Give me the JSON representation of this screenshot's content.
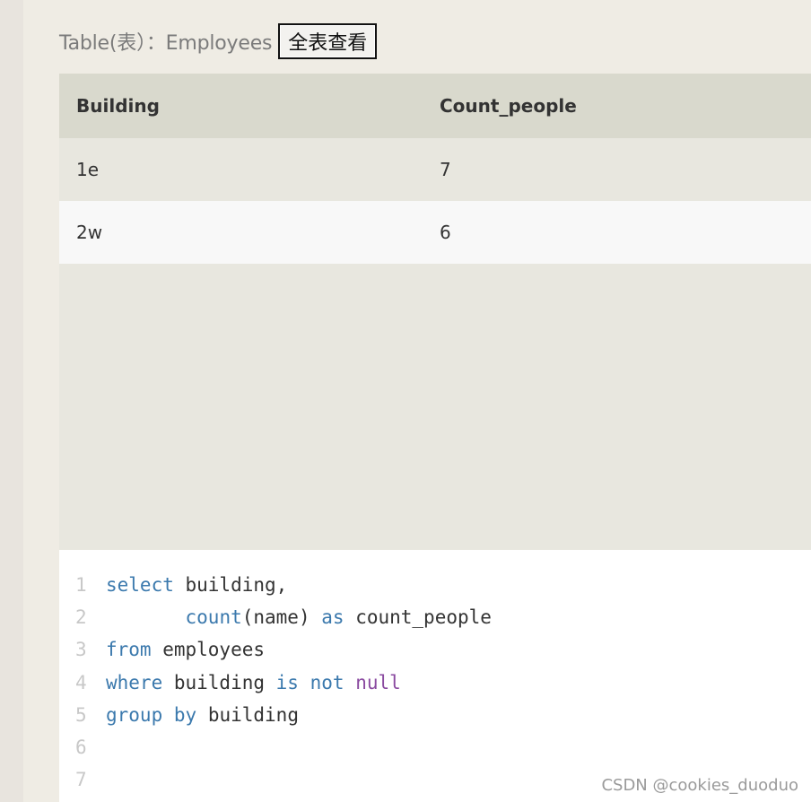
{
  "header": {
    "table_label": "Table(表）：Employees",
    "view_all_button": "全表查看"
  },
  "results": {
    "columns": [
      "Building",
      "Count_people"
    ],
    "rows": [
      [
        "1e",
        "7"
      ],
      [
        "2w",
        "6"
      ]
    ]
  },
  "editor": {
    "line_numbers": [
      "1",
      "2",
      "3",
      "4",
      "5",
      "6",
      "7"
    ],
    "lines": [
      [
        {
          "t": "select",
          "c": "kw"
        },
        {
          "t": " building,",
          "c": "id"
        }
      ],
      [
        {
          "t": "       ",
          "c": "id"
        },
        {
          "t": "count",
          "c": "kw"
        },
        {
          "t": "(name) ",
          "c": "id"
        },
        {
          "t": "as",
          "c": "kw"
        },
        {
          "t": " count_people",
          "c": "id"
        }
      ],
      [
        {
          "t": "from",
          "c": "kw"
        },
        {
          "t": " employees",
          "c": "id"
        }
      ],
      [
        {
          "t": "where",
          "c": "kw"
        },
        {
          "t": " building ",
          "c": "id"
        },
        {
          "t": "is",
          "c": "kw"
        },
        {
          "t": " ",
          "c": "id"
        },
        {
          "t": "not",
          "c": "kw"
        },
        {
          "t": " ",
          "c": "id"
        },
        {
          "t": "null",
          "c": "nl"
        }
      ],
      [
        {
          "t": "group",
          "c": "kw"
        },
        {
          "t": " ",
          "c": "id"
        },
        {
          "t": "by",
          "c": "kw"
        },
        {
          "t": " building",
          "c": "id"
        }
      ],
      [],
      []
    ]
  },
  "watermark": "CSDN @cookies_duoduo"
}
